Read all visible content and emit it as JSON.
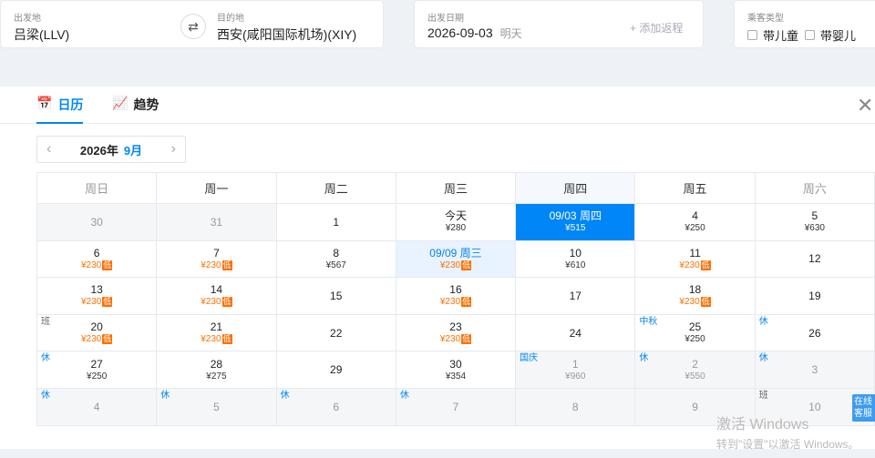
{
  "search": {
    "origin": {
      "label": "出发地",
      "value": "吕梁(LLV)"
    },
    "swap_glyph": "⇄",
    "destination": {
      "label": "目的地",
      "value": "西安(咸阳国际机场)(XIY)"
    },
    "depart": {
      "label": "出发日期",
      "value": "2026-09-03",
      "note": "明天"
    },
    "add_return": "+ 添加返程",
    "passenger": {
      "label": "乘客类型",
      "options": [
        "带儿童",
        "带婴儿"
      ]
    }
  },
  "tabs": [
    {
      "label": "日历",
      "icon": "calendar-icon",
      "glyph": "📅",
      "active": true
    },
    {
      "label": "趋势",
      "icon": "trend-chart-icon",
      "glyph": "📈",
      "active": false
    }
  ],
  "close_glyph": "✕",
  "month_nav": {
    "prev": "‹",
    "year": "2026年",
    "month": "9月",
    "next": "›"
  },
  "weekdays": [
    "周日",
    "周一",
    "周二",
    "周三",
    "周四",
    "周五",
    "周六"
  ],
  "low_label": "低",
  "calendar": [
    [
      {
        "day": "30",
        "price": "",
        "other": true
      },
      {
        "day": "31",
        "price": "",
        "other": true
      },
      {
        "day": "1",
        "price": ""
      },
      {
        "day": "今天",
        "price": "¥280"
      },
      {
        "day": "09/03 周四",
        "price": "¥515",
        "selected": true
      },
      {
        "day": "4",
        "price": "¥250"
      },
      {
        "day": "5",
        "price": "¥630"
      }
    ],
    [
      {
        "day": "6",
        "price": "¥230",
        "low": true
      },
      {
        "day": "7",
        "price": "¥230",
        "low": true
      },
      {
        "day": "8",
        "price": "¥567"
      },
      {
        "day": "09/09 周三",
        "price": "¥230",
        "low": true,
        "highlight": true
      },
      {
        "day": "10",
        "price": "¥610"
      },
      {
        "day": "11",
        "price": "¥230",
        "low": true
      },
      {
        "day": "12",
        "price": ""
      }
    ],
    [
      {
        "day": "13",
        "price": "¥230",
        "low": true
      },
      {
        "day": "14",
        "price": "¥230",
        "low": true
      },
      {
        "day": "15",
        "price": ""
      },
      {
        "day": "16",
        "price": "¥230",
        "low": true
      },
      {
        "day": "17",
        "price": ""
      },
      {
        "day": "18",
        "price": "¥230",
        "low": true
      },
      {
        "day": "19",
        "price": ""
      }
    ],
    [
      {
        "day": "20",
        "price": "¥230",
        "low": true,
        "tag": "班",
        "tagType": "work"
      },
      {
        "day": "21",
        "price": "¥230",
        "low": true
      },
      {
        "day": "22",
        "price": ""
      },
      {
        "day": "23",
        "price": "¥230",
        "low": true
      },
      {
        "day": "24",
        "price": ""
      },
      {
        "day": "25",
        "price": "¥250",
        "tag": "中秋",
        "tagType": "rest"
      },
      {
        "day": "26",
        "price": "",
        "tag": "休",
        "tagType": "rest"
      }
    ],
    [
      {
        "day": "27",
        "price": "¥250",
        "tag": "休",
        "tagType": "rest"
      },
      {
        "day": "28",
        "price": "¥275"
      },
      {
        "day": "29",
        "price": ""
      },
      {
        "day": "30",
        "price": "¥354"
      },
      {
        "day": "1",
        "price": "¥960",
        "other": true,
        "tag": "国庆",
        "tagType": "rest"
      },
      {
        "day": "2",
        "price": "¥550",
        "other": true,
        "tag": "休",
        "tagType": "rest"
      },
      {
        "day": "3",
        "price": "",
        "other": true,
        "tag": "休",
        "tagType": "rest"
      }
    ],
    [
      {
        "day": "4",
        "price": "",
        "other": true,
        "tag": "休",
        "tagType": "rest"
      },
      {
        "day": "5",
        "price": "",
        "other": true,
        "tag": "休",
        "tagType": "rest"
      },
      {
        "day": "6",
        "price": "",
        "other": true,
        "tag": "休",
        "tagType": "rest"
      },
      {
        "day": "7",
        "price": "",
        "other": true,
        "tag": "休",
        "tagType": "rest"
      },
      {
        "day": "8",
        "price": "",
        "other": true
      },
      {
        "day": "9",
        "price": "",
        "other": true
      },
      {
        "day": "10",
        "price": "",
        "other": true,
        "tag": "班",
        "tagType": "work"
      }
    ]
  ],
  "watermark": {
    "line1": "激活 Windows",
    "line2": "转到\"设置\"以激活 Windows。"
  },
  "service": "在线客服"
}
